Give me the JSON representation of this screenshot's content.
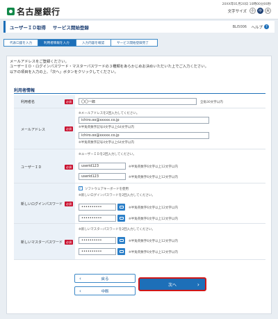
{
  "header": {
    "logo_text": "名古屋銀行",
    "datetime": "20XX年01月20日 10時00分00秒",
    "fontsize_label": "文字サイズ",
    "fontsize_small": "小",
    "fontsize_medium": "中",
    "fontsize_large": "大"
  },
  "title": {
    "main": "ユーザーＩＤ取得",
    "sub": "サービス開始登録",
    "code": "BLI5006",
    "help_label": "ヘルプ",
    "help_icon": "?"
  },
  "steps": [
    {
      "label": "代表口座を入力",
      "active": false
    },
    {
      "label": "利用者情報を入力",
      "active": true
    },
    {
      "label": "入力内容を確認",
      "active": false
    },
    {
      "label": "サービス開始登録完了",
      "active": false
    }
  ],
  "intro": {
    "line1": "メールアドレスをご登録ください。",
    "line2": "ユーザーＩＤ・ログインパスワード・マスターパスワードの３種類をあらかじめお決めいただいた上でご入力ください。",
    "line3": "以下の項目を入力の上、「次へ」ボタンをクリックしてください。"
  },
  "section_title": "利用者情報",
  "required_label": "必須",
  "form": {
    "name": {
      "label": "利用者名",
      "value": "〇〇一郎",
      "note": "全角30文字以内"
    },
    "email": {
      "label": "メールアドレス",
      "instruction": "※メールアドレスを2回入力してください。",
      "value1": "ichiro.oo@xxxxx.co.jp",
      "note1": "※半角英数字記号4文字以上64文字以内",
      "value2": "ichiro.oo@xxxxx.co.jp",
      "note2": "※半角英数字記号4文字以上64文字以内"
    },
    "user_id": {
      "label": "ユーザーＩＤ",
      "instruction": "※ユーザーＩＤを2回入力してください。",
      "value1": "userid123",
      "note1": "※半角英数字6文字以上12文字以内",
      "value2": "userid123",
      "note2": "※半角英数字6文字以上12文字以内"
    },
    "login_password": {
      "label": "新しいログインパスワード",
      "software_keyboard": "ソフトウェアキーボードを使用",
      "instruction": "※新しいログインパスワードを2回入力してください。",
      "value1": "••••••••••",
      "note1": "※半角英数字6文字以上12文字以内",
      "value2": "••••••••••",
      "note2": "※半角英数字6文字以上12文字以内"
    },
    "master_password": {
      "label": "新しいマスターパスワード",
      "instruction": "※新しいマスターパスワードを2回入力してください。",
      "value1": "••••••••••",
      "note1": "※半角英数字6文字以上12文字以内",
      "value2": "••••••••••",
      "note2": "※半角英数字6文字以上12文字以内"
    }
  },
  "buttons": {
    "back": "戻る",
    "stop": "中断",
    "next": "次へ",
    "chev_left": "‹",
    "chev_right": "›"
  },
  "colors": {
    "accent": "#1d6fb8",
    "required": "#c8102e",
    "highlight_border": "#d01616"
  }
}
